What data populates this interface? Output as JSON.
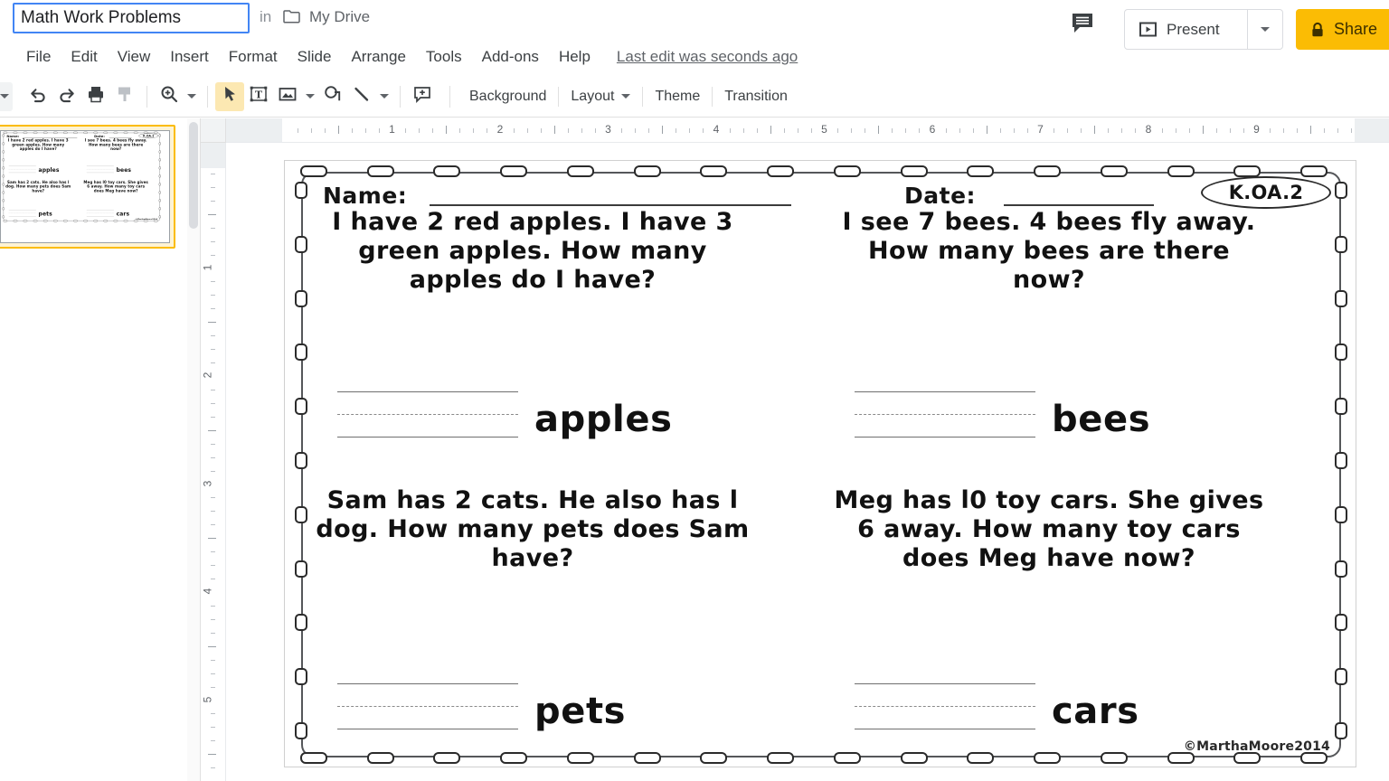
{
  "titlebar": {
    "doc_title": "Math Work Problems",
    "in_word": "in",
    "folder_icon": "folder-icon",
    "drive_name": "My Drive",
    "comment_icon": "comment-icon",
    "present_icon": "present-play-icon",
    "present_label": "Present",
    "present_caret_icon": "chevron-down-icon",
    "share_lock_icon": "lock-icon",
    "share_label": "Share"
  },
  "menubar": {
    "items": [
      {
        "label": "File"
      },
      {
        "label": "Edit"
      },
      {
        "label": "View"
      },
      {
        "label": "Insert"
      },
      {
        "label": "Format"
      },
      {
        "label": "Slide"
      },
      {
        "label": "Arrange"
      },
      {
        "label": "Tools"
      },
      {
        "label": "Add-ons"
      },
      {
        "label": "Help"
      }
    ],
    "last_edit": "Last edit was seconds ago"
  },
  "toolbar": {
    "icons": [
      {
        "name": "undo-icon"
      },
      {
        "name": "redo-icon"
      },
      {
        "name": "print-icon"
      },
      {
        "name": "paint-format-icon"
      },
      {
        "name": "zoom-icon"
      },
      {
        "name": "select-cursor-icon"
      },
      {
        "name": "text-box-icon"
      },
      {
        "name": "insert-image-icon"
      },
      {
        "name": "shape-icon"
      },
      {
        "name": "line-icon"
      },
      {
        "name": "comment-add-icon"
      }
    ],
    "background_label": "Background",
    "layout_label": "Layout",
    "theme_label": "Theme",
    "transition_label": "Transition"
  },
  "rulers": {
    "horizontal_numbers": [
      "1",
      "2",
      "3",
      "4",
      "5",
      "6",
      "7",
      "8",
      "9"
    ],
    "vertical_numbers": [
      "1",
      "2",
      "3",
      "4",
      "5"
    ]
  },
  "filmstrip": {
    "slide_count": 1,
    "selected_slide": 1
  },
  "slide": {
    "name_label": "Name:",
    "date_label": "Date:",
    "standard_badge": "K.OA.2",
    "problems": [
      {
        "text": "I have 2 red apples. I have 3 green apples. How many apples do I have?",
        "answer_label": "apples"
      },
      {
        "text": "I see 7 bees. 4 bees fly away. How many bees are there now?",
        "answer_label": "bees"
      },
      {
        "text": "Sam has 2 cats. He also has l dog. How many pets does Sam have?",
        "answer_label": "pets"
      },
      {
        "text": "Meg has l0 toy cars. She gives 6 away. How many toy cars does Meg have now?",
        "answer_label": "cars"
      }
    ],
    "copyright": "©MarthaMoore2014"
  },
  "colors": {
    "share_yellow": "#fbbc04",
    "title_border_blue": "#4285f4",
    "selected_thumb": "#fbbc04",
    "text_dark": "#3c4043"
  }
}
